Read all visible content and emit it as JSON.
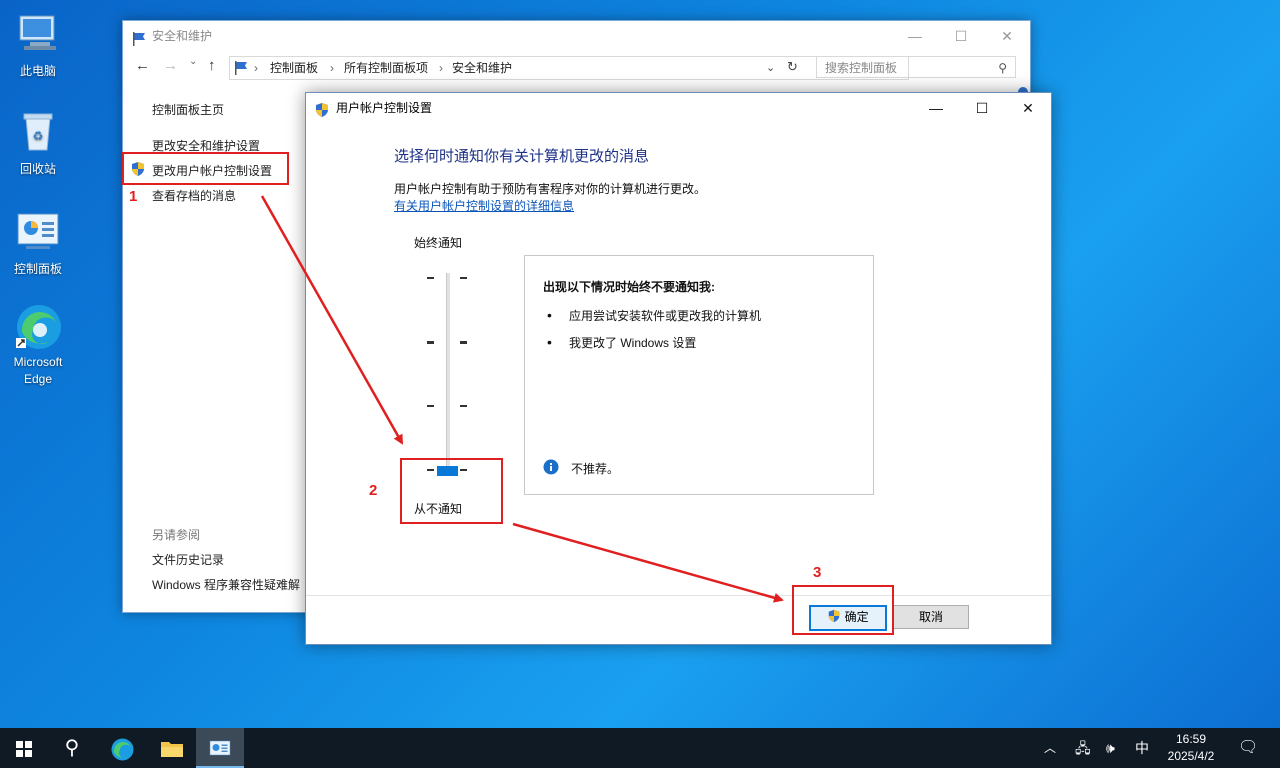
{
  "desktop": {
    "icons": [
      {
        "label": "此电脑"
      },
      {
        "label": "回收站"
      },
      {
        "label": "控制面板"
      },
      {
        "label": "Microsoft Edge"
      }
    ]
  },
  "control_panel": {
    "title": "安全和维护",
    "breadcrumbs": [
      "控制面板",
      "所有控制面板项",
      "安全和维护"
    ],
    "search_placeholder": "搜索控制面板",
    "nav": {
      "home": "控制面板主页",
      "change_security": "更改安全和维护设置",
      "change_uac": "更改用户帐户控制设置",
      "archived": "查看存档的消息",
      "see_also": "另请参阅",
      "file_history": "文件历史记录",
      "compat": "Windows 程序兼容性疑难解"
    }
  },
  "uac_dialog": {
    "title": "用户帐户控制设置",
    "heading": "选择何时通知你有关计算机更改的消息",
    "description": "用户帐户控制有助于预防有害程序对你的计算机进行更改。",
    "link": "有关用户帐户控制设置的详细信息",
    "slider": {
      "top_label": "始终通知",
      "bottom_label": "从不通知",
      "level": 0,
      "levels": 4
    },
    "info": {
      "heading": "出现以下情况时始终不要通知我:",
      "bullets": [
        "应用尝试安装软件或更改我的计算机",
        "我更改了 Windows 设置"
      ],
      "note": "不推荐。"
    },
    "buttons": {
      "ok": "确定",
      "cancel": "取消"
    }
  },
  "annotations": [
    "1",
    "2",
    "3"
  ],
  "taskbar": {
    "time": "16:59",
    "date": "2025/4/2",
    "ime": "中"
  },
  "colors": {
    "accent": "#0a78d7",
    "annotation": "#e02020",
    "heading": "#1e3287"
  }
}
